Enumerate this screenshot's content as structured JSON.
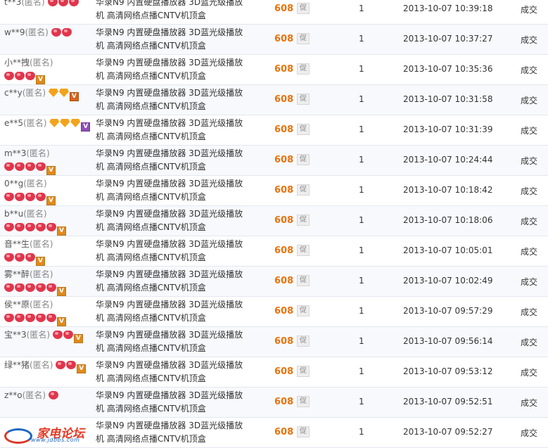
{
  "records": [
    {
      "buyer": "t**3",
      "anon": "(匿名)",
      "icons": [
        "heart",
        "heart",
        "heart"
      ],
      "vip": "",
      "product": "华录N9 内置硬盘播放器 3D蓝光级播放机 高清网络点播CNTV机顶盒",
      "price": "608",
      "promo": "促",
      "qty": "1",
      "time": "2013-10-07 10:39:18",
      "status": "成交"
    },
    {
      "buyer": "w**9",
      "anon": "(匿名)",
      "icons": [
        "heart",
        "heart"
      ],
      "vip": "",
      "product": "华录N9 内置硬盘播放器 3D蓝光级播放机 高清网络点播CNTV机顶盒",
      "price": "608",
      "promo": "促",
      "qty": "1",
      "time": "2013-10-07 10:37:27",
      "status": "成交"
    },
    {
      "buyer": "小**拽",
      "anon": "(匿名)",
      "icons": [
        "heart",
        "heart",
        "heart"
      ],
      "vip": "V2",
      "product": "华录N9 内置硬盘播放器 3D蓝光级播放机 高清网络点播CNTV机顶盒",
      "price": "608",
      "promo": "促",
      "qty": "1",
      "time": "2013-10-07 10:35:36",
      "status": "成交"
    },
    {
      "buyer": "c**y",
      "anon": "(匿名)",
      "icons": [
        "diamond",
        "diamond"
      ],
      "vip": "V1",
      "product": "华录N9 内置硬盘播放器 3D蓝光级播放机 高清网络点播CNTV机顶盒",
      "price": "608",
      "promo": "促",
      "qty": "1",
      "time": "2013-10-07 10:31:58",
      "status": "成交"
    },
    {
      "buyer": "e**5",
      "anon": "(匿名)",
      "icons": [
        "diamond",
        "diamond",
        "diamond"
      ],
      "vip": "V3",
      "product": "华录N9 内置硬盘播放器 3D蓝光级播放机 高清网络点播CNTV机顶盒",
      "price": "608",
      "promo": "促",
      "qty": "1",
      "time": "2013-10-07 10:31:39",
      "status": "成交"
    },
    {
      "buyer": "m**3",
      "anon": "(匿名)",
      "icons": [
        "heart",
        "heart",
        "heart",
        "heart"
      ],
      "vip": "V2",
      "product": "华录N9 内置硬盘播放器 3D蓝光级播放机 高清网络点播CNTV机顶盒",
      "price": "608",
      "promo": "促",
      "qty": "1",
      "time": "2013-10-07 10:24:44",
      "status": "成交"
    },
    {
      "buyer": "0**g",
      "anon": "(匿名)",
      "icons": [
        "heart",
        "heart",
        "heart",
        "heart"
      ],
      "vip": "V2",
      "product": "华录N9 内置硬盘播放器 3D蓝光级播放机 高清网络点播CNTV机顶盒",
      "price": "608",
      "promo": "促",
      "qty": "1",
      "time": "2013-10-07 10:18:42",
      "status": "成交"
    },
    {
      "buyer": "b**u",
      "anon": "(匿名)",
      "icons": [
        "heart",
        "heart",
        "heart",
        "heart",
        "heart"
      ],
      "vip": "V2",
      "product": "华录N9 内置硬盘播放器 3D蓝光级播放机 高清网络点播CNTV机顶盒",
      "price": "608",
      "promo": "促",
      "qty": "1",
      "time": "2013-10-07 10:18:06",
      "status": "成交"
    },
    {
      "buyer": "音**生",
      "anon": "(匿名)",
      "icons": [
        "heart",
        "heart",
        "heart"
      ],
      "vip": "V2",
      "product": "华录N9 内置硬盘播放器 3D蓝光级播放机 高清网络点播CNTV机顶盒",
      "price": "608",
      "promo": "促",
      "qty": "1",
      "time": "2013-10-07 10:05:01",
      "status": "成交"
    },
    {
      "buyer": "雾**醉",
      "anon": "(匿名)",
      "icons": [
        "heart",
        "heart",
        "heart",
        "heart",
        "heart"
      ],
      "vip": "V2",
      "product": "华录N9 内置硬盘播放器 3D蓝光级播放机 高清网络点播CNTV机顶盒",
      "price": "608",
      "promo": "促",
      "qty": "1",
      "time": "2013-10-07 10:02:49",
      "status": "成交"
    },
    {
      "buyer": "侯**原",
      "anon": "(匿名)",
      "icons": [
        "heart",
        "heart",
        "heart",
        "heart",
        "heart"
      ],
      "vip": "V2",
      "product": "华录N9 内置硬盘播放器 3D蓝光级播放机 高清网络点播CNTV机顶盒",
      "price": "608",
      "promo": "促",
      "qty": "1",
      "time": "2013-10-07 09:57:29",
      "status": "成交"
    },
    {
      "buyer": "宝**3",
      "anon": "(匿名)",
      "icons": [
        "heart",
        "heart"
      ],
      "vip": "V2",
      "product": "华录N9 内置硬盘播放器 3D蓝光级播放机 高清网络点播CNTV机顶盒",
      "price": "608",
      "promo": "促",
      "qty": "1",
      "time": "2013-10-07 09:56:14",
      "status": "成交"
    },
    {
      "buyer": "绿**猪",
      "anon": "(匿名)",
      "icons": [
        "heart",
        "heart"
      ],
      "vip": "V2",
      "product": "华录N9 内置硬盘播放器 3D蓝光级播放机 高清网络点播CNTV机顶盒",
      "price": "608",
      "promo": "促",
      "qty": "1",
      "time": "2013-10-07 09:53:12",
      "status": "成交"
    },
    {
      "buyer": "z**o",
      "anon": "(匿名)",
      "icons": [
        "heart"
      ],
      "vip": "",
      "product": "华录N9 内置硬盘播放器 3D蓝光级播放机 高清网络点播CNTV机顶盒",
      "price": "608",
      "promo": "促",
      "qty": "1",
      "time": "2013-10-07 09:52:51",
      "status": "成交"
    },
    {
      "buyer": "",
      "anon": "",
      "icons": [],
      "vip": "",
      "product": "华录N9 内置硬盘播放器 3D蓝光级播放机 高清网络点播CNTV机顶盒",
      "price": "608",
      "promo": "促",
      "qty": "1",
      "time": "2013-10-07 09:52:27",
      "status": "成交"
    }
  ],
  "watermark": {
    "text": "家电论坛",
    "url": "www.jdbbs.com"
  },
  "colors": {
    "price": "#e8730c",
    "heart": "#e0364c",
    "diamond": "#f2a31b",
    "row_alt": "#f7f9fc"
  }
}
